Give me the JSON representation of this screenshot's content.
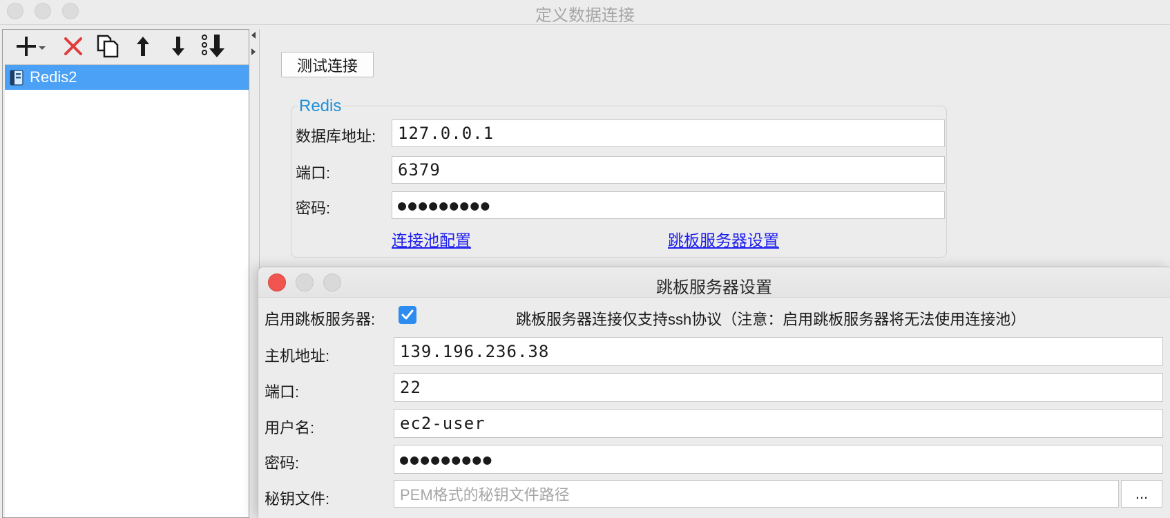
{
  "window": {
    "title": "定义数据连接"
  },
  "toolbar": {
    "icons": [
      "add-icon",
      "delete-icon",
      "copy-icon",
      "move-up-icon",
      "move-down-icon",
      "move-bottom-icon"
    ]
  },
  "tree": {
    "items": [
      {
        "label": "Redis2",
        "icon": "database-icon",
        "selected": true
      }
    ]
  },
  "main": {
    "test_button": "测试连接",
    "group_title": "Redis",
    "fields": {
      "host_label": "数据库地址:",
      "host_value": "127.0.0.1",
      "port_label": "端口:",
      "port_value": "6379",
      "password_label": "密码:",
      "password_value": "●●●●●●●●●"
    },
    "links": {
      "pool_config": "连接池配置",
      "jump_server": "跳板服务器设置"
    }
  },
  "dialog": {
    "title": "跳板服务器设置",
    "enable_label": "启用跳板服务器:",
    "enable_checked": true,
    "note": "跳板服务器连接仅支持ssh协议（注意：启用跳板服务器将无法使用连接池）",
    "host_label": "主机地址:",
    "host_value": "139.196.236.38",
    "port_label": "端口:",
    "port_value": "22",
    "user_label": "用户名:",
    "user_value": "ec2-user",
    "password_label": "密码:",
    "password_value": "●●●●●●●●●",
    "keyfile_label": "秘钥文件:",
    "keyfile_placeholder": "PEM格式的秘钥文件路径",
    "browse_button": "..."
  },
  "colors": {
    "selection": "#4aa1f5",
    "link": "#1e1eee",
    "group_title": "#1e90d6",
    "checkbox": "#2d8cf0",
    "close_button": "#f0564f"
  }
}
